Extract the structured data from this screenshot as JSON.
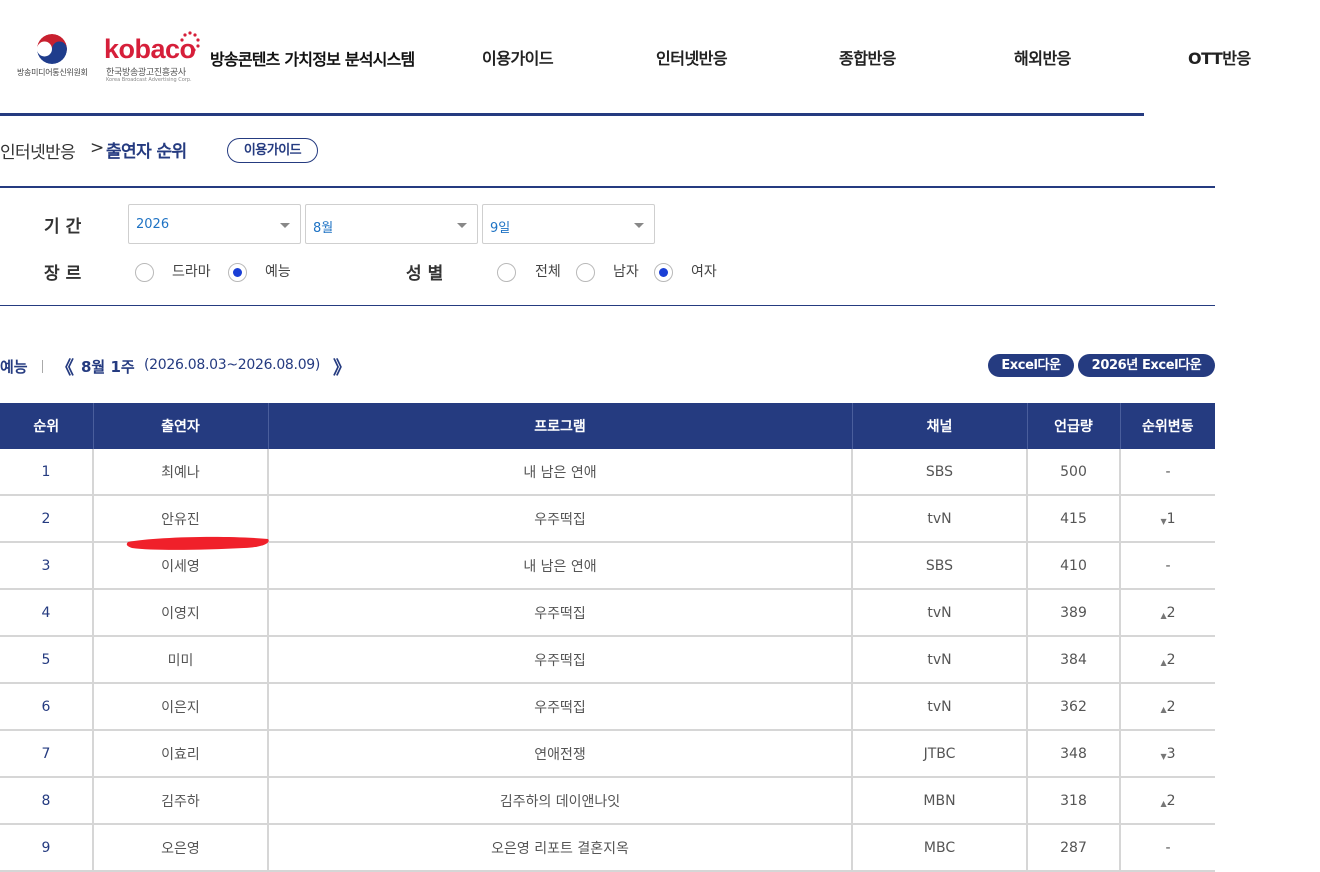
{
  "header": {
    "gov_name": "방송미디어통신위원회",
    "kobaco_word": "kobaco",
    "kobaco_kr": "한국방송광고진흥공사",
    "kobaco_en": "Korea Broadcast Advertising Corp.",
    "system_title": "방송콘텐츠 가치정보 분석시스템",
    "nav": [
      "이용가이드",
      "인터넷반응",
      "종합반응",
      "해외반응",
      "OTT반응"
    ]
  },
  "breadcrumb": {
    "parent": "인터넷반응",
    "separator": ">",
    "current": "출연자 순위",
    "guide_button": "이용가이드"
  },
  "filters": {
    "period_label": "기간",
    "year": "2026",
    "month": "8월",
    "week": "9일",
    "genre_label": "장르",
    "genre_options": [
      {
        "label": "드라마",
        "checked": false
      },
      {
        "label": "예능",
        "checked": true
      }
    ],
    "gender_label": "성별",
    "gender_options": [
      {
        "label": "전체",
        "checked": false
      },
      {
        "label": "남자",
        "checked": false
      },
      {
        "label": "여자",
        "checked": true
      }
    ]
  },
  "week_bar": {
    "category": "예능",
    "prev": "《",
    "title": "8월 1주",
    "range": "(2026.08.03~2026.08.09)",
    "next": "》",
    "excel_button": "Excel다운",
    "excel_year_button": "2026년 Excel다운"
  },
  "table": {
    "columns": [
      "순위",
      "출연자",
      "프로그램",
      "채널",
      "언급량",
      "순위변동"
    ],
    "rows": [
      {
        "rank": "1",
        "name": "최예나",
        "program": "내 남은 연애",
        "channel": "SBS",
        "mentions": "500",
        "arrow": "",
        "change": "-"
      },
      {
        "rank": "2",
        "name": "안유진",
        "program": "우주떡집",
        "channel": "tvN",
        "mentions": "415",
        "arrow": "▼",
        "change": "1"
      },
      {
        "rank": "3",
        "name": "이세영",
        "program": "내 남은 연애",
        "channel": "SBS",
        "mentions": "410",
        "arrow": "",
        "change": "-"
      },
      {
        "rank": "4",
        "name": "이영지",
        "program": "우주떡집",
        "channel": "tvN",
        "mentions": "389",
        "arrow": "▲",
        "change": "2"
      },
      {
        "rank": "5",
        "name": "미미",
        "program": "우주떡집",
        "channel": "tvN",
        "mentions": "384",
        "arrow": "▲",
        "change": "2"
      },
      {
        "rank": "6",
        "name": "이은지",
        "program": "우주떡집",
        "channel": "tvN",
        "mentions": "362",
        "arrow": "▲",
        "change": "2"
      },
      {
        "rank": "7",
        "name": "이효리",
        "program": "연애전쟁",
        "channel": "JTBC",
        "mentions": "348",
        "arrow": "▼",
        "change": "3"
      },
      {
        "rank": "8",
        "name": "김주하",
        "program": "김주하의 데이앤나잇",
        "channel": "MBN",
        "mentions": "318",
        "arrow": "▲",
        "change": "2"
      },
      {
        "rank": "9",
        "name": "오은영",
        "program": "오은영 리포트 결혼지옥",
        "channel": "MBC",
        "mentions": "287",
        "arrow": "",
        "change": "-"
      }
    ]
  },
  "colors": {
    "brand_navy": "#253b80",
    "kobaco_red": "#d61f3a",
    "radio_checked": "#1a3fd6",
    "annotation_red": "#f0202a"
  }
}
